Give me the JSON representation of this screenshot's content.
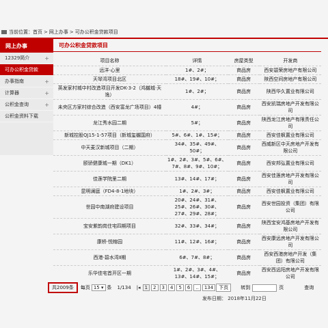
{
  "breadcrumb": {
    "label": "当前位置：",
    "items": [
      "首页",
      "网上办事",
      "可办公积金贷款项目"
    ]
  },
  "sidebar": {
    "title": "网上办事",
    "items": [
      {
        "label": "12329简介",
        "expand": "+"
      },
      {
        "label": "可办公积金贷款",
        "expand": ""
      },
      {
        "label": "办事指南",
        "expand": "+"
      },
      {
        "label": "计算器",
        "expand": "+"
      },
      {
        "label": "公积金查询",
        "expand": "+"
      },
      {
        "label": "公积金资料下载",
        "expand": ""
      }
    ]
  },
  "panel": {
    "title": "可办公积金贷款项目"
  },
  "table": {
    "headers": [
      "项目名称",
      "详情",
      "房屋类型",
      "开发商"
    ],
    "rows": [
      [
        "远洋·心里",
        "1#、2#；",
        "商品房",
        "西安碧荣房地产有限公司"
      ],
      [
        "天琴湾项目北区",
        "18#、19#、10#；",
        "商品房",
        "陕西空间房地产有限公司"
      ],
      [
        "英发家村城中村改造项目开发DK-3-2（鸿樾城·天逸）",
        "1#、2#；",
        "商品房",
        "陕西华久置业有限公司"
      ],
      [
        "未央区方家村综合改造（西安富龙广场项目）4幢",
        "4#；",
        "商品房",
        "西安凯瑞房地产开发有限公司"
      ],
      [
        "龙江秀水园二期",
        "5#；",
        "商品房",
        "陕西龙江房地产有限责任公司"
      ],
      [
        "新城控股QJ15-1-57项目（新城玺樾国府）",
        "5#、6#、1#、15#；",
        "商品房",
        "西安佳枫置业有限公司"
      ],
      [
        "中天麦汉新城项目（二期）",
        "34#、35#、49#、50#；",
        "商品房",
        "西威新区中天房地产开发有限公司"
      ],
      [
        "颐骄健康城一期（DK1）",
        "1#、2#、3#、5#、6#、7#、8#、9#、10#；",
        "商品房",
        "西安邦弘置业有限公司"
      ],
      [
        "佳莲学院里二期",
        "13#、14#、17#；",
        "商品房",
        "西安佳莲房地产开发有限公司"
      ],
      [
        "昆明澜庭（FD4-8-1地块）",
        "1#、2#、3#；",
        "商品房",
        "西安佳枫置业有限公司"
      ],
      [
        "世园中南湖府建设项目",
        "20#、24#、31#、25#、26#、30#、27#、29#、28#；",
        "商品房",
        "西安世园投资（集团）有限公司"
      ],
      [
        "宝安紫韵岗住宅四期项目",
        "32#、33#、34#；",
        "商品房",
        "陕西宝安鸿基房地产开发有限公司"
      ],
      [
        "康桥·悦榕园",
        "11#、12#、16#；",
        "商品房",
        "西安康远房地产开发有限公司"
      ],
      [
        "西港·碧水湾Ⅱ期",
        "6#、7#、8#；",
        "商品房",
        "西安西港房地产开发（集团）有限公司"
      ],
      [
        "乐华佳宅首开区一期",
        "1#、2#、3#、4#、13#、14#、15#；",
        "商品房",
        "西安西远阳房地产开发有限公司"
      ]
    ]
  },
  "pager": {
    "total": "共2009条",
    "per_page_label": "每页",
    "per_page_value": "15",
    "per_page_unit": "条",
    "page_info": "1/134",
    "pages": [
      "1",
      "2",
      "3",
      "4",
      "5",
      "6",
      "..",
      "134"
    ],
    "next": "下页",
    "goto_label": "转到",
    "page_unit": "页",
    "query_button": "查询"
  },
  "publish_date": "发布日期： 2018年11月22日",
  "colors": {
    "accent": "#c00000",
    "sidebar_bg": "#eaeaea"
  }
}
